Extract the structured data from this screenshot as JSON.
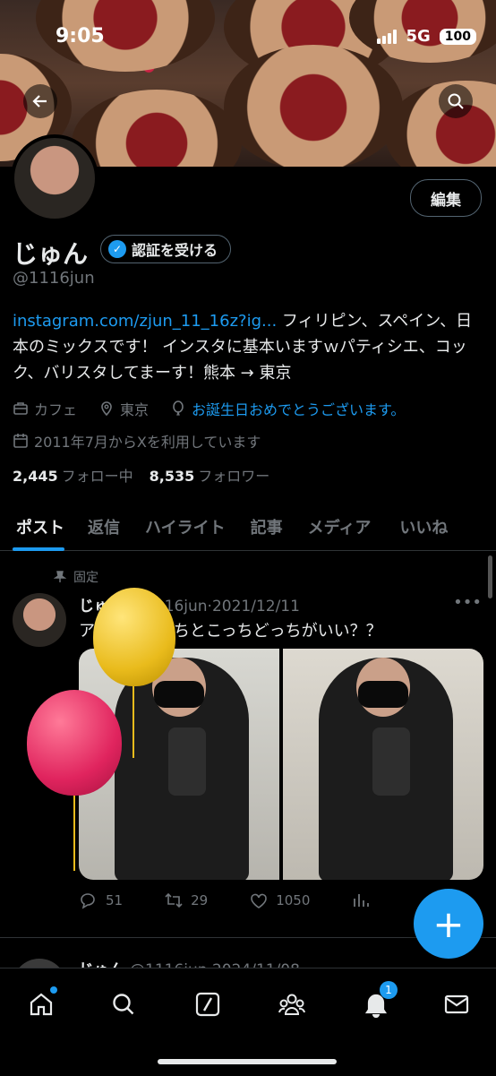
{
  "status": {
    "time": "9:05",
    "network": "5G",
    "battery": "100"
  },
  "profile": {
    "name": "じゅん",
    "handle": "@1116jun",
    "verify_label": "認証を受ける",
    "edit_label": "編集",
    "bio_link": "instagram.com/zjun_11_16z?ig...",
    "bio_text": " フィリピン、スペイン、日本のミックスです！ インスタに基本いますｗパティシエ、コック、バリスタしてまーす！熊本 → 東京",
    "category": "カフェ",
    "location": "東京",
    "birthday": "お誕生日おめでとうございます。",
    "joined": "2011年7月からXを利用しています",
    "following_count": "2,445",
    "following_label": "フォロー中",
    "followers_count": "8,535",
    "followers_label": "フォロワー"
  },
  "tabs": [
    {
      "label": "ポスト"
    },
    {
      "label": "返信"
    },
    {
      "label": "ハイライト"
    },
    {
      "label": "記事"
    },
    {
      "label": "メディア"
    },
    {
      "label": "いいね"
    }
  ],
  "pinned_post": {
    "pinned_label": "固定",
    "author": "じゅん",
    "handle": "@1116jun",
    "date": "2021/12/11",
    "text": "アイコンこっちとこっちどっちがいい？？",
    "replies": "51",
    "reposts": "29",
    "likes": "1050"
  },
  "second_post": {
    "author": "じゅん",
    "handle": "@1116jun",
    "date": "2024/11/08"
  },
  "nav": {
    "notifications_badge": "1"
  },
  "colors": {
    "accent": "#1d9bf0",
    "background": "#000000"
  }
}
